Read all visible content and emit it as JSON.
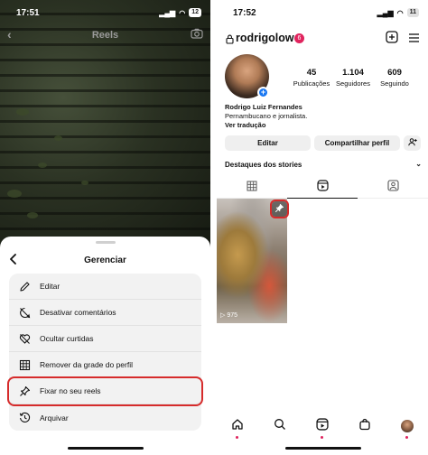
{
  "left": {
    "status": {
      "time": "17:51",
      "battery": "12"
    },
    "header": {
      "title": "Reels"
    },
    "sheet": {
      "title": "Gerenciar",
      "items": [
        {
          "label": "Editar",
          "icon": "pencil-icon"
        },
        {
          "label": "Desativar comentários",
          "icon": "comment-off-icon"
        },
        {
          "label": "Ocultar curtidas",
          "icon": "heart-off-icon"
        },
        {
          "label": "Remover da grade do perfil",
          "icon": "grid-remove-icon"
        },
        {
          "label": "Fixar no seu reels",
          "icon": "pin-icon",
          "highlighted": true
        },
        {
          "label": "Arquivar",
          "icon": "archive-icon"
        }
      ]
    }
  },
  "right": {
    "status": {
      "time": "17:52",
      "battery": "11"
    },
    "profile": {
      "username": "rodrigolow",
      "notification_count": "6",
      "stats": [
        {
          "value": "45",
          "label": "Publicações"
        },
        {
          "value": "1.104",
          "label": "Seguidores"
        },
        {
          "value": "609",
          "label": "Seguindo"
        }
      ],
      "full_name": "Rodrigo Luiz Fernandes",
      "bio": "Pernambucano e jornalista.",
      "translate": "Ver tradução"
    },
    "buttons": {
      "edit": "Editar",
      "share": "Compartilhar perfil"
    },
    "highlights_label": "Destaques dos stories",
    "reel": {
      "views": "975"
    },
    "accent_colors": {
      "highlight_border": "#d62b2b",
      "notification": "#e0245e",
      "add_avatar": "#1877f2"
    }
  }
}
